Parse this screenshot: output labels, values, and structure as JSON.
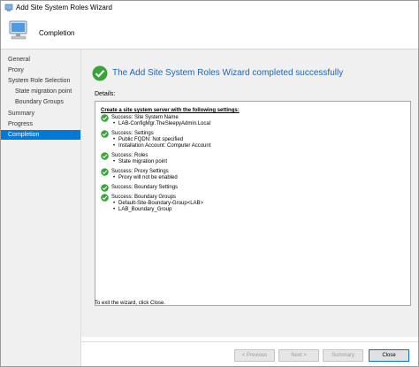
{
  "window": {
    "title": "Add Site System Roles Wizard"
  },
  "header": {
    "heading": "Completion"
  },
  "sidebar": {
    "items": [
      {
        "label": "General",
        "sub": false,
        "active": false
      },
      {
        "label": "Proxy",
        "sub": false,
        "active": false
      },
      {
        "label": "System Role Selection",
        "sub": false,
        "active": false
      },
      {
        "label": "State migration point",
        "sub": true,
        "active": false
      },
      {
        "label": "Boundary Groups",
        "sub": true,
        "active": false
      },
      {
        "label": "Summary",
        "sub": false,
        "active": false
      },
      {
        "label": "Progress",
        "sub": false,
        "active": false
      },
      {
        "label": "Completion",
        "sub": false,
        "active": true
      }
    ]
  },
  "main": {
    "success_title": "The Add Site System Roles Wizard completed successfully",
    "details_label": "Details:",
    "details_heading": "Create a site system server with the following settings:",
    "entries": [
      {
        "title": "Success: Site System Name",
        "items": [
          "LAB-ConfigMgr.TheSleepyAdmin.Local"
        ]
      },
      {
        "title": "Success: Settings",
        "items": [
          "Public FQDN: Not specified",
          "Installation Account: Computer Account"
        ]
      },
      {
        "title": "Success: Roles",
        "items": [
          "State migration point"
        ]
      },
      {
        "title": "Success: Proxy Settings",
        "items": [
          "Proxy will not be enabled"
        ]
      },
      {
        "title": "Success: Boundary Settings",
        "items": []
      },
      {
        "title": "Success: Boundary Groups",
        "items": [
          "Default-Site-Boundary-Group<LAB>",
          "LAB_Boundary_Group"
        ]
      }
    ],
    "bullet": "•",
    "exit_text": "To exit the wizard, click Close."
  },
  "buttons": {
    "previous": "< Previous",
    "next": "Next >",
    "summary": "Summary",
    "close": "Close"
  },
  "colors": {
    "accent": "#0078d7",
    "success_green": "#3aa33a",
    "title_blue": "#1e66b4"
  }
}
